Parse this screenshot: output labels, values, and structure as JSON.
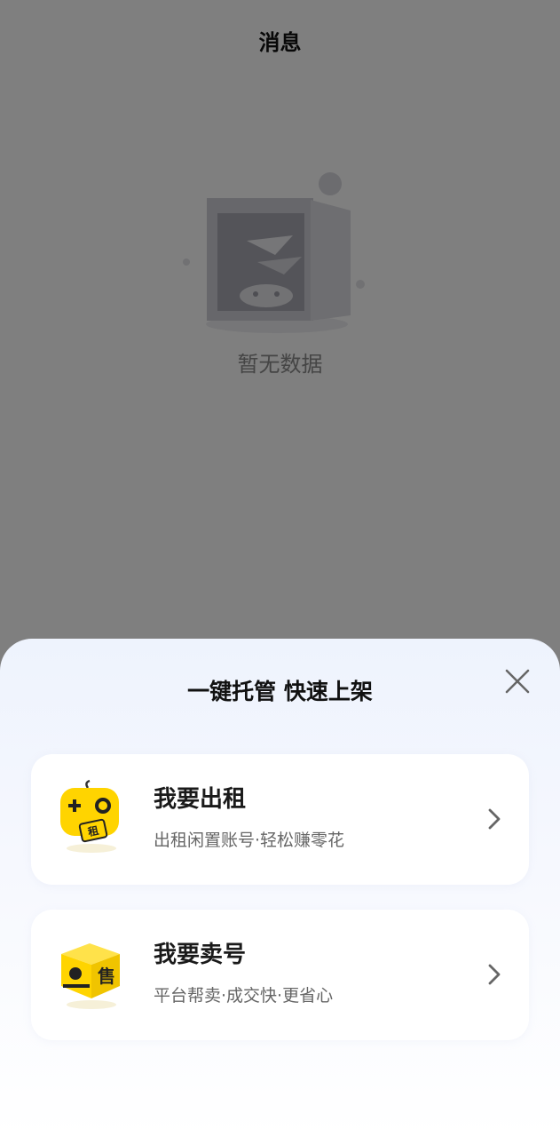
{
  "page": {
    "title": "消息",
    "empty_text": "暂无数据"
  },
  "sheet": {
    "title": "一键托管 快速上架",
    "options": [
      {
        "title": "我要出租",
        "subtitle": "出租闲置账号·轻松赚零花",
        "badge": "租"
      },
      {
        "title": "我要卖号",
        "subtitle": "平台帮卖·成交快·更省心",
        "badge": "售"
      }
    ]
  },
  "colors": {
    "accent_yellow": "#FFD400",
    "overlay": "rgba(0,0,0,0.5)"
  },
  "icons": [
    "close-icon",
    "rent-gamepad-icon",
    "sell-box-icon",
    "chevron-right-icon",
    "empty-safe-illustration"
  ]
}
